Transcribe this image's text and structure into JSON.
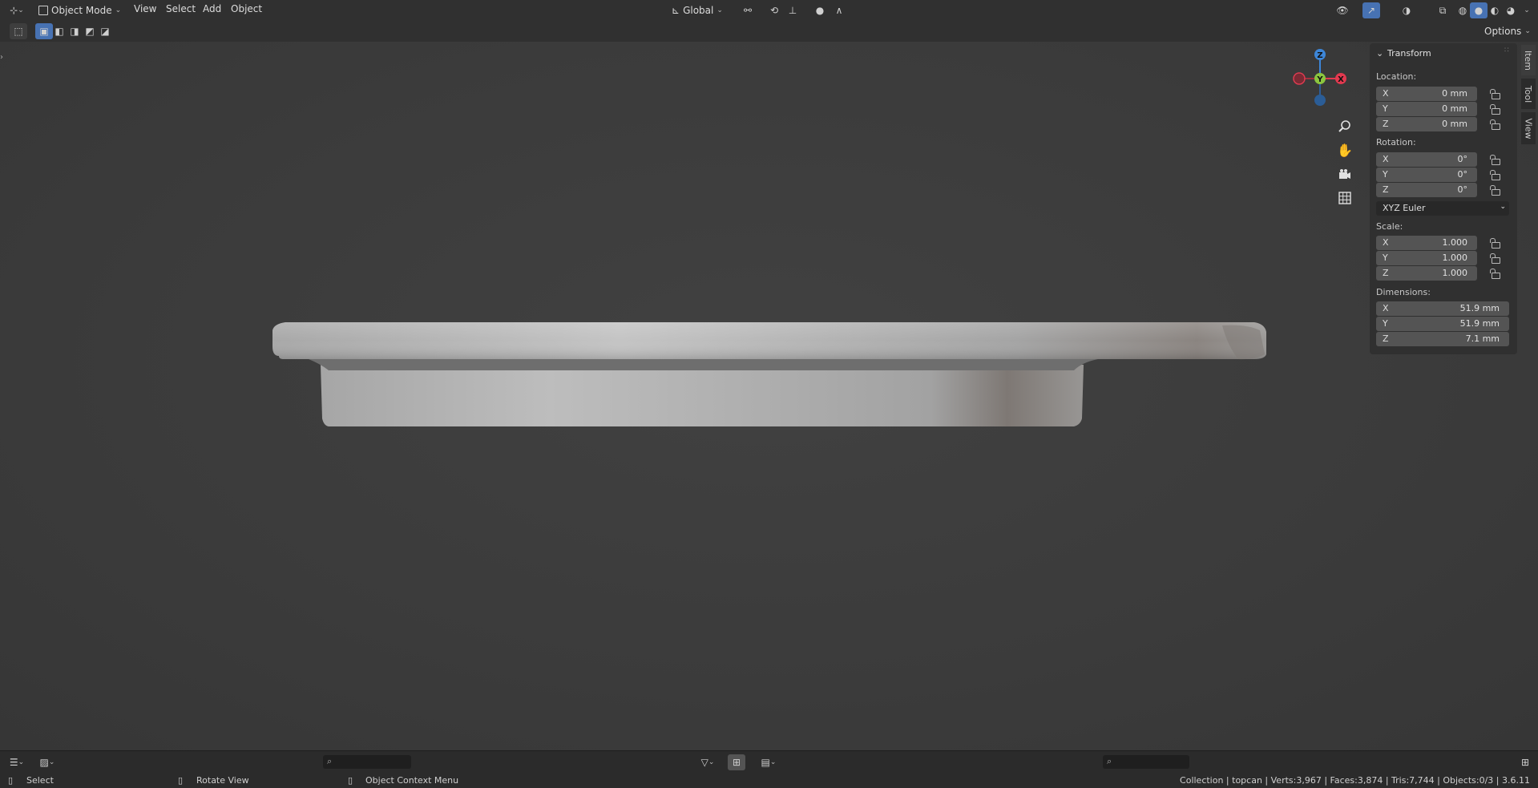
{
  "header": {
    "mode_label": "Object Mode",
    "menus": [
      "View",
      "Select",
      "Add",
      "Object"
    ],
    "transform_orientation": "Global",
    "options_label": "Options"
  },
  "npanel": {
    "title": "Transform",
    "location_label": "Location:",
    "location": [
      {
        "axis": "X",
        "value": "0 mm"
      },
      {
        "axis": "Y",
        "value": "0 mm"
      },
      {
        "axis": "Z",
        "value": "0 mm"
      }
    ],
    "rotation_label": "Rotation:",
    "rotation": [
      {
        "axis": "X",
        "value": "0°"
      },
      {
        "axis": "Y",
        "value": "0°"
      },
      {
        "axis": "Z",
        "value": "0°"
      }
    ],
    "rotation_mode": "XYZ Euler",
    "scale_label": "Scale:",
    "scale": [
      {
        "axis": "X",
        "value": "1.000"
      },
      {
        "axis": "Y",
        "value": "1.000"
      },
      {
        "axis": "Z",
        "value": "1.000"
      }
    ],
    "dimensions_label": "Dimensions:",
    "dimensions": [
      {
        "axis": "X",
        "value": "51.9 mm"
      },
      {
        "axis": "Y",
        "value": "51.9 mm"
      },
      {
        "axis": "Z",
        "value": "7.1 mm"
      }
    ]
  },
  "side_tabs": [
    "Item",
    "Tool",
    "View"
  ],
  "gizmo": {
    "z": "Z",
    "y": "Y",
    "x": "X",
    "colors": {
      "x": "#e2394f",
      "y": "#8bc53f",
      "z": "#3d86d8"
    }
  },
  "status": {
    "select": "Select",
    "rotate": "Rotate View",
    "context": "Object Context Menu",
    "info": "Collection | topcan | Verts:3,967 | Faces:3,874 | Tris:7,744 | Objects:0/3 | 3.6.11"
  },
  "colors": {
    "accent": "#4772b3",
    "panel": "#303030",
    "field": "#545454"
  }
}
